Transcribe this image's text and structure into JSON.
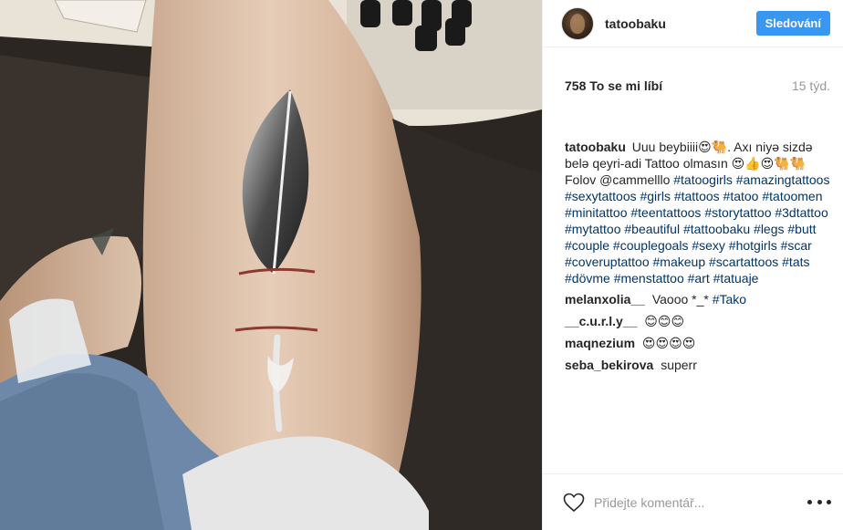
{
  "post": {
    "username": "tatoobaku",
    "follow_label": "Sledování",
    "likes": "758 To se mi líbí",
    "time_ago": "15 týd."
  },
  "caption": {
    "username": "tatoobaku",
    "line1": "Uuu beybiiii😍🐫. Axı niyə sizdə belə qeyri-adi Tattoo olmasın 😍👍😍🐫🐫 Folov @cammelllo",
    "hashtags": "#tatoogirls #amazingtattoos #sexytattoos #girls #tattoos #tatoo #tatoomen #minitattoo #teentattoos #storytattoo #3dtattoo #mytattoo #beautiful #tattoobaku #legs #butt #couple #couplegoals #sexy #hotgirls #scar #coveruptattoo #makeup #scartattoos #tats #dövme #menstattoo #art #tatuaje"
  },
  "comments": [
    {
      "user": "melanxolia__",
      "text": "Vaooo *_* ",
      "tag": "#Tako"
    },
    {
      "user": "__c.u.r.l.y__",
      "text": "😊😊😊",
      "tag": ""
    },
    {
      "user": "maqnezium",
      "text": "😍😍😍😍",
      "tag": ""
    },
    {
      "user": "seba_bekirova",
      "text": "superr",
      "tag": ""
    }
  ],
  "footer": {
    "comment_placeholder": "Přidejte komentář...",
    "heart_icon": "heart-outline-icon",
    "more_icon": "more-horizontal-icon"
  },
  "colors": {
    "follow_button": "#3897f0",
    "hashtag": "#003569",
    "muted": "#999999"
  }
}
